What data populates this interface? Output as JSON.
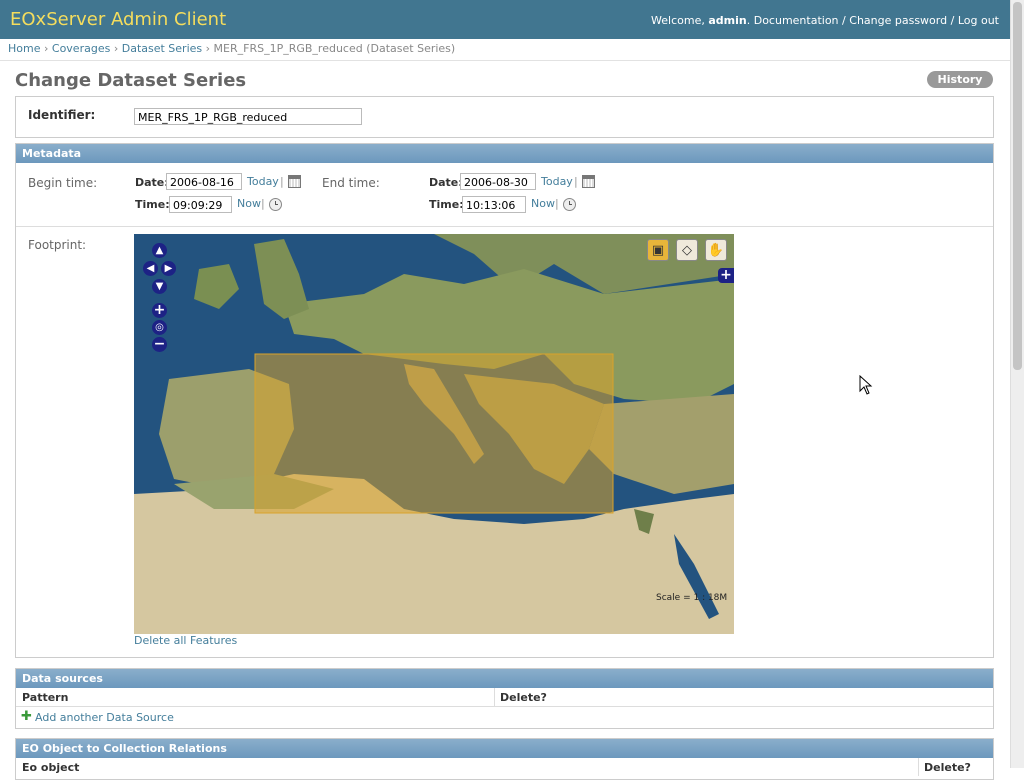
{
  "header": {
    "brand": "EOxServer Admin Client",
    "welcome": "Welcome,",
    "user": "admin",
    "documentation": "Documentation",
    "change_password": "Change password",
    "logout": "Log out",
    "sep": "/",
    "period": "."
  },
  "breadcrumbs": {
    "home": "Home",
    "coverages": "Coverages",
    "dataset_series": "Dataset Series",
    "current": "MER_FRS_1P_RGB_reduced (Dataset Series)",
    "sep": "›"
  },
  "page": {
    "title": "Change Dataset Series",
    "history": "History"
  },
  "identifier": {
    "label": "Identifier:",
    "value": "MER_FRS_1P_RGB_reduced"
  },
  "metadata": {
    "heading": "Metadata",
    "begin_label": "Begin time:",
    "end_label": "End time:",
    "date_label": "Date:",
    "time_label": "Time:",
    "today": "Today",
    "now": "Now",
    "sep": "|",
    "begin_date": "2006-08-16",
    "begin_time": "09:09:29",
    "end_date": "2006-08-30",
    "end_time": "10:13:06",
    "footprint_label": "Footprint:",
    "delete_features": "Delete all Features",
    "scale_text": "Scale = 1 : 18M"
  },
  "data_sources": {
    "heading": "Data sources",
    "col_pattern": "Pattern",
    "col_delete": "Delete?",
    "add_link": "Add another Data Source"
  },
  "relations": {
    "heading": "EO Object to Collection Relations",
    "col_object": "Eo object",
    "col_delete": "Delete?"
  },
  "colors": {
    "header_bg": "#417690",
    "brand": "#f5dd5d",
    "section_head": "#7ca0c7",
    "link": "#447e9b",
    "footprint_fill": "#d9a32b"
  }
}
